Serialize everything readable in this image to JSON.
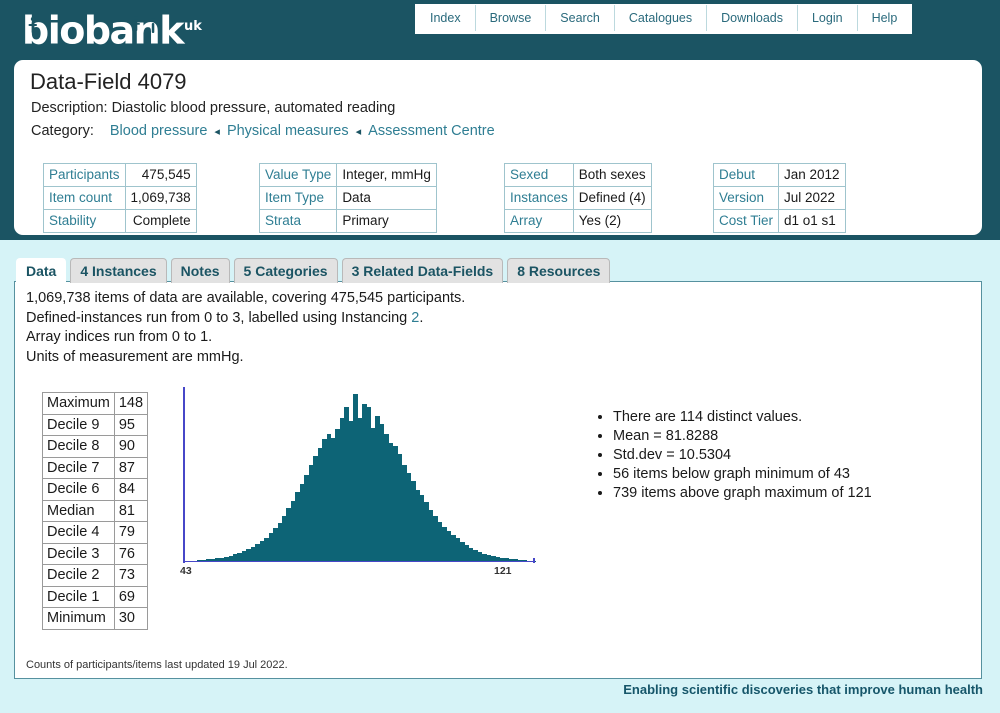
{
  "brand": {
    "logo_text": "biobank",
    "logo_sup": "uk"
  },
  "nav": {
    "items": [
      {
        "label": "Index"
      },
      {
        "label": "Browse"
      },
      {
        "label": "Search"
      },
      {
        "label": "Catalogues"
      },
      {
        "label": "Downloads"
      },
      {
        "label": "Login"
      },
      {
        "label": "Help"
      }
    ]
  },
  "field": {
    "title": "Data-Field 4079",
    "description_label": "Description:",
    "description": "Diastolic blood pressure, automated reading",
    "category_label": "Category:",
    "category_path": [
      "Blood pressure",
      "Physical measures",
      "Assessment Centre"
    ],
    "category_separator": "◂"
  },
  "meta_tables": [
    {
      "rows": [
        {
          "key": "Participants",
          "value": "475,545",
          "numeric": true
        },
        {
          "key": "Item count",
          "value": "1,069,738",
          "numeric": true
        },
        {
          "key": "Stability",
          "value": "Complete",
          "numeric": true
        }
      ]
    },
    {
      "rows": [
        {
          "key": "Value Type",
          "value": "Integer, mmHg",
          "numeric": false
        },
        {
          "key": "Item Type",
          "value": "Data",
          "numeric": false
        },
        {
          "key": "Strata",
          "value": "Primary",
          "numeric": false
        }
      ]
    },
    {
      "rows": [
        {
          "key": "Sexed",
          "value": "Both sexes",
          "numeric": false
        },
        {
          "key": "Instances",
          "value": "Defined (4)",
          "numeric": false
        },
        {
          "key": "Array",
          "value": "Yes (2)",
          "numeric": false
        }
      ]
    },
    {
      "rows": [
        {
          "key": "Debut",
          "value": "Jan 2012",
          "numeric": false
        },
        {
          "key": "Version",
          "value": "Jul 2022",
          "numeric": false
        },
        {
          "key": "Cost Tier",
          "value": "d1 o1 s1",
          "numeric": false
        }
      ]
    }
  ],
  "tabs": [
    {
      "label": "Data",
      "active": true
    },
    {
      "label": "4 Instances",
      "active": false
    },
    {
      "label": "Notes",
      "active": false
    },
    {
      "label": "5 Categories",
      "active": false
    },
    {
      "label": "3 Related Data-Fields",
      "active": false
    },
    {
      "label": "8 Resources",
      "active": false
    }
  ],
  "summary": {
    "line1": "1,069,738 items of data are available, covering 475,545 participants.",
    "line2_pre": "Defined-instances run from 0 to 3, labelled using Instancing ",
    "line2_link": "2",
    "line2_post": ".",
    "line3": "Array indices run from 0 to 1.",
    "line4": "Units of measurement are mmHg."
  },
  "deciles": [
    {
      "label": "Maximum",
      "value": "148"
    },
    {
      "label": "Decile 9",
      "value": "95"
    },
    {
      "label": "Decile 8",
      "value": "90"
    },
    {
      "label": "Decile 7",
      "value": "87"
    },
    {
      "label": "Decile 6",
      "value": "84"
    },
    {
      "label": "Median",
      "value": "81"
    },
    {
      "label": "Decile 4",
      "value": "79"
    },
    {
      "label": "Decile 3",
      "value": "76"
    },
    {
      "label": "Decile 2",
      "value": "73"
    },
    {
      "label": "Decile 1",
      "value": "69"
    },
    {
      "label": "Minimum",
      "value": "30"
    }
  ],
  "stats": [
    "There are 114 distinct values.",
    "Mean = 81.8288",
    "Std.dev = 10.5304",
    "56 items below graph minimum of 43",
    "739 items above graph maximum of 121"
  ],
  "footnote": "Counts of participants/items last updated 19 Jul 2022.",
  "tagline": "Enabling scientific discoveries that improve human health",
  "colors": {
    "band": "#1b5463",
    "page_bg": "#d6f3f7",
    "link": "#2f7e93",
    "bar": "#0d6476",
    "axis": "#4747c8",
    "tab_active_bg": "#ffffff",
    "tab_bg": "#e2e2e2"
  },
  "chart_data": {
    "type": "bar",
    "title": "",
    "xlabel": "",
    "ylabel": "",
    "axis_labels": {
      "min": "43",
      "max": "121"
    },
    "xlim": [
      43,
      121
    ],
    "grid": false,
    "legend": null,
    "note": "Histogram of diastolic blood pressure (mmHg); bin width 1 mmHg from 43 to 121. Values are relative frequency counts normalised to peak = 100.",
    "categories": [
      43,
      44,
      45,
      46,
      47,
      48,
      49,
      50,
      51,
      52,
      53,
      54,
      55,
      56,
      57,
      58,
      59,
      60,
      61,
      62,
      63,
      64,
      65,
      66,
      67,
      68,
      69,
      70,
      71,
      72,
      73,
      74,
      75,
      76,
      77,
      78,
      79,
      80,
      81,
      82,
      83,
      84,
      85,
      86,
      87,
      88,
      89,
      90,
      91,
      92,
      93,
      94,
      95,
      96,
      97,
      98,
      99,
      100,
      101,
      102,
      103,
      104,
      105,
      106,
      107,
      108,
      109,
      110,
      111,
      112,
      113,
      114,
      115,
      116,
      117,
      118,
      119,
      120,
      121
    ],
    "values": [
      0.5,
      0.6,
      0.8,
      1.0,
      1.2,
      1.5,
      1.8,
      2.2,
      2.6,
      3.2,
      3.8,
      4.6,
      5.5,
      6.5,
      7.6,
      9.0,
      10.5,
      12.5,
      14.5,
      17.0,
      20.0,
      23.5,
      27.5,
      32.0,
      36.5,
      41.5,
      46.5,
      52.0,
      57.5,
      63.0,
      68.0,
      73.5,
      76.0,
      74.0,
      79.0,
      86.0,
      92.0,
      84.0,
      100.0,
      86.0,
      94.0,
      92.0,
      80.0,
      87.0,
      82.0,
      76.0,
      71.0,
      69.0,
      64.0,
      58.0,
      53.0,
      48.0,
      43.0,
      40.0,
      36.0,
      31.0,
      27.5,
      24.0,
      21.0,
      18.5,
      16.0,
      14.0,
      12.0,
      10.0,
      8.5,
      7.2,
      6.0,
      5.0,
      4.2,
      3.5,
      3.0,
      2.5,
      2.1,
      1.8,
      1.5,
      1.2,
      1.0,
      0.8,
      0.6
    ]
  }
}
